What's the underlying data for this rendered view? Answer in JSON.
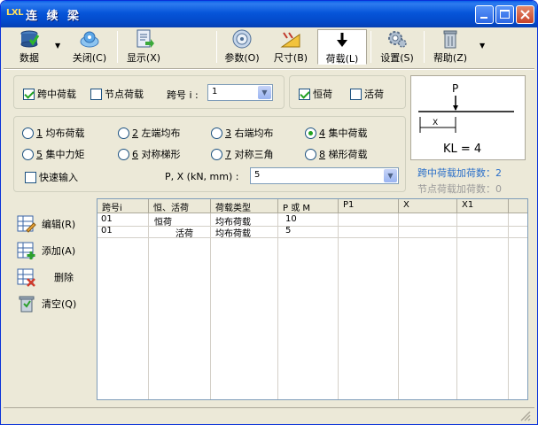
{
  "window": {
    "logo": "LXL",
    "title": "连 续 梁"
  },
  "toolbar": {
    "data": "数据",
    "close": "关闭(C)",
    "display": "显示(X)",
    "params": "参数(O)",
    "size": "尺寸(B)",
    "load": "荷载(L)",
    "settings": "设置(S)",
    "help": "帮助(Z)"
  },
  "load_options": {
    "midspan_load": "跨中荷载",
    "node_load": "节点荷载",
    "span_label": "跨号 i :",
    "span_value": "1",
    "dead_load": "恒荷",
    "live_load": "活荷"
  },
  "load_types": [
    {
      "num": "1",
      "label": "均布荷载"
    },
    {
      "num": "2",
      "label": "左端均布"
    },
    {
      "num": "3",
      "label": "右端均布"
    },
    {
      "num": "4",
      "label": "集中荷载"
    },
    {
      "num": "5",
      "label": "集中力矩"
    },
    {
      "num": "6",
      "label": "对称梯形"
    },
    {
      "num": "7",
      "label": "对称三角"
    },
    {
      "num": "8",
      "label": "梯形荷载"
    }
  ],
  "quick_input": "快速输入",
  "px_label": "P, X (kN, mm) :",
  "px_value": "5",
  "diagram": {
    "p": "P",
    "x": "X",
    "kl": "KL = 4"
  },
  "counts": {
    "midspan": "跨中荷载加荷数：2",
    "node": "节点荷载加荷数：0"
  },
  "colors": {
    "midspan_count": "#2A6FC9",
    "node_count": "#9A9A9A"
  },
  "side_buttons": {
    "edit": "编辑(R)",
    "add": "添加(A)",
    "delete": "删除",
    "clear": "清空(Q)"
  },
  "table": {
    "columns": [
      "跨号i",
      "恒、活荷",
      "荷载类型",
      "P 或 M",
      "P1",
      "X",
      "X1"
    ],
    "rows": [
      [
        "01",
        "恒荷",
        "均布荷载",
        "10",
        "",
        "",
        ""
      ],
      [
        "01",
        "活荷",
        "均布荷载",
        "5",
        "",
        "",
        ""
      ]
    ]
  }
}
